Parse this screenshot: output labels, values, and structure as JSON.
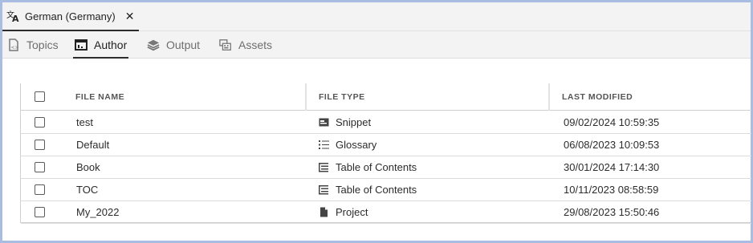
{
  "doc_tab": {
    "title": "German (Germany)",
    "close_label": "✕"
  },
  "nav": {
    "tabs": [
      {
        "label": "Topics",
        "icon": "topics-icon",
        "active": false
      },
      {
        "label": "Author",
        "icon": "author-icon",
        "active": true
      },
      {
        "label": "Output",
        "icon": "layers-icon",
        "active": false
      },
      {
        "label": "Assets",
        "icon": "assets-icon",
        "active": false
      }
    ]
  },
  "table": {
    "headers": {
      "file_name": "FILE NAME",
      "file_type": "FILE TYPE",
      "last_modified": "LAST MODIFIED"
    },
    "rows": [
      {
        "name": "test",
        "type": "Snippet",
        "type_icon": "snippet-icon",
        "modified": "09/02/2024 10:59:35"
      },
      {
        "name": "Default",
        "type": "Glossary",
        "type_icon": "glossary-icon",
        "modified": "06/08/2023 10:09:53"
      },
      {
        "name": "Book",
        "type": "Table of Contents",
        "type_icon": "toc-icon",
        "modified": "30/01/2024 17:14:30"
      },
      {
        "name": "TOC",
        "type": "Table of Contents",
        "type_icon": "toc-icon",
        "modified": "10/11/2023 08:58:59"
      },
      {
        "name": "My_2022",
        "type": "Project",
        "type_icon": "project-icon",
        "modified": "29/08/2023 15:50:46"
      }
    ]
  },
  "colors": {
    "frame_border": "#a9bde3",
    "tabbar_bg": "#f3f3f3",
    "active_underline": "#2c2c2c"
  }
}
